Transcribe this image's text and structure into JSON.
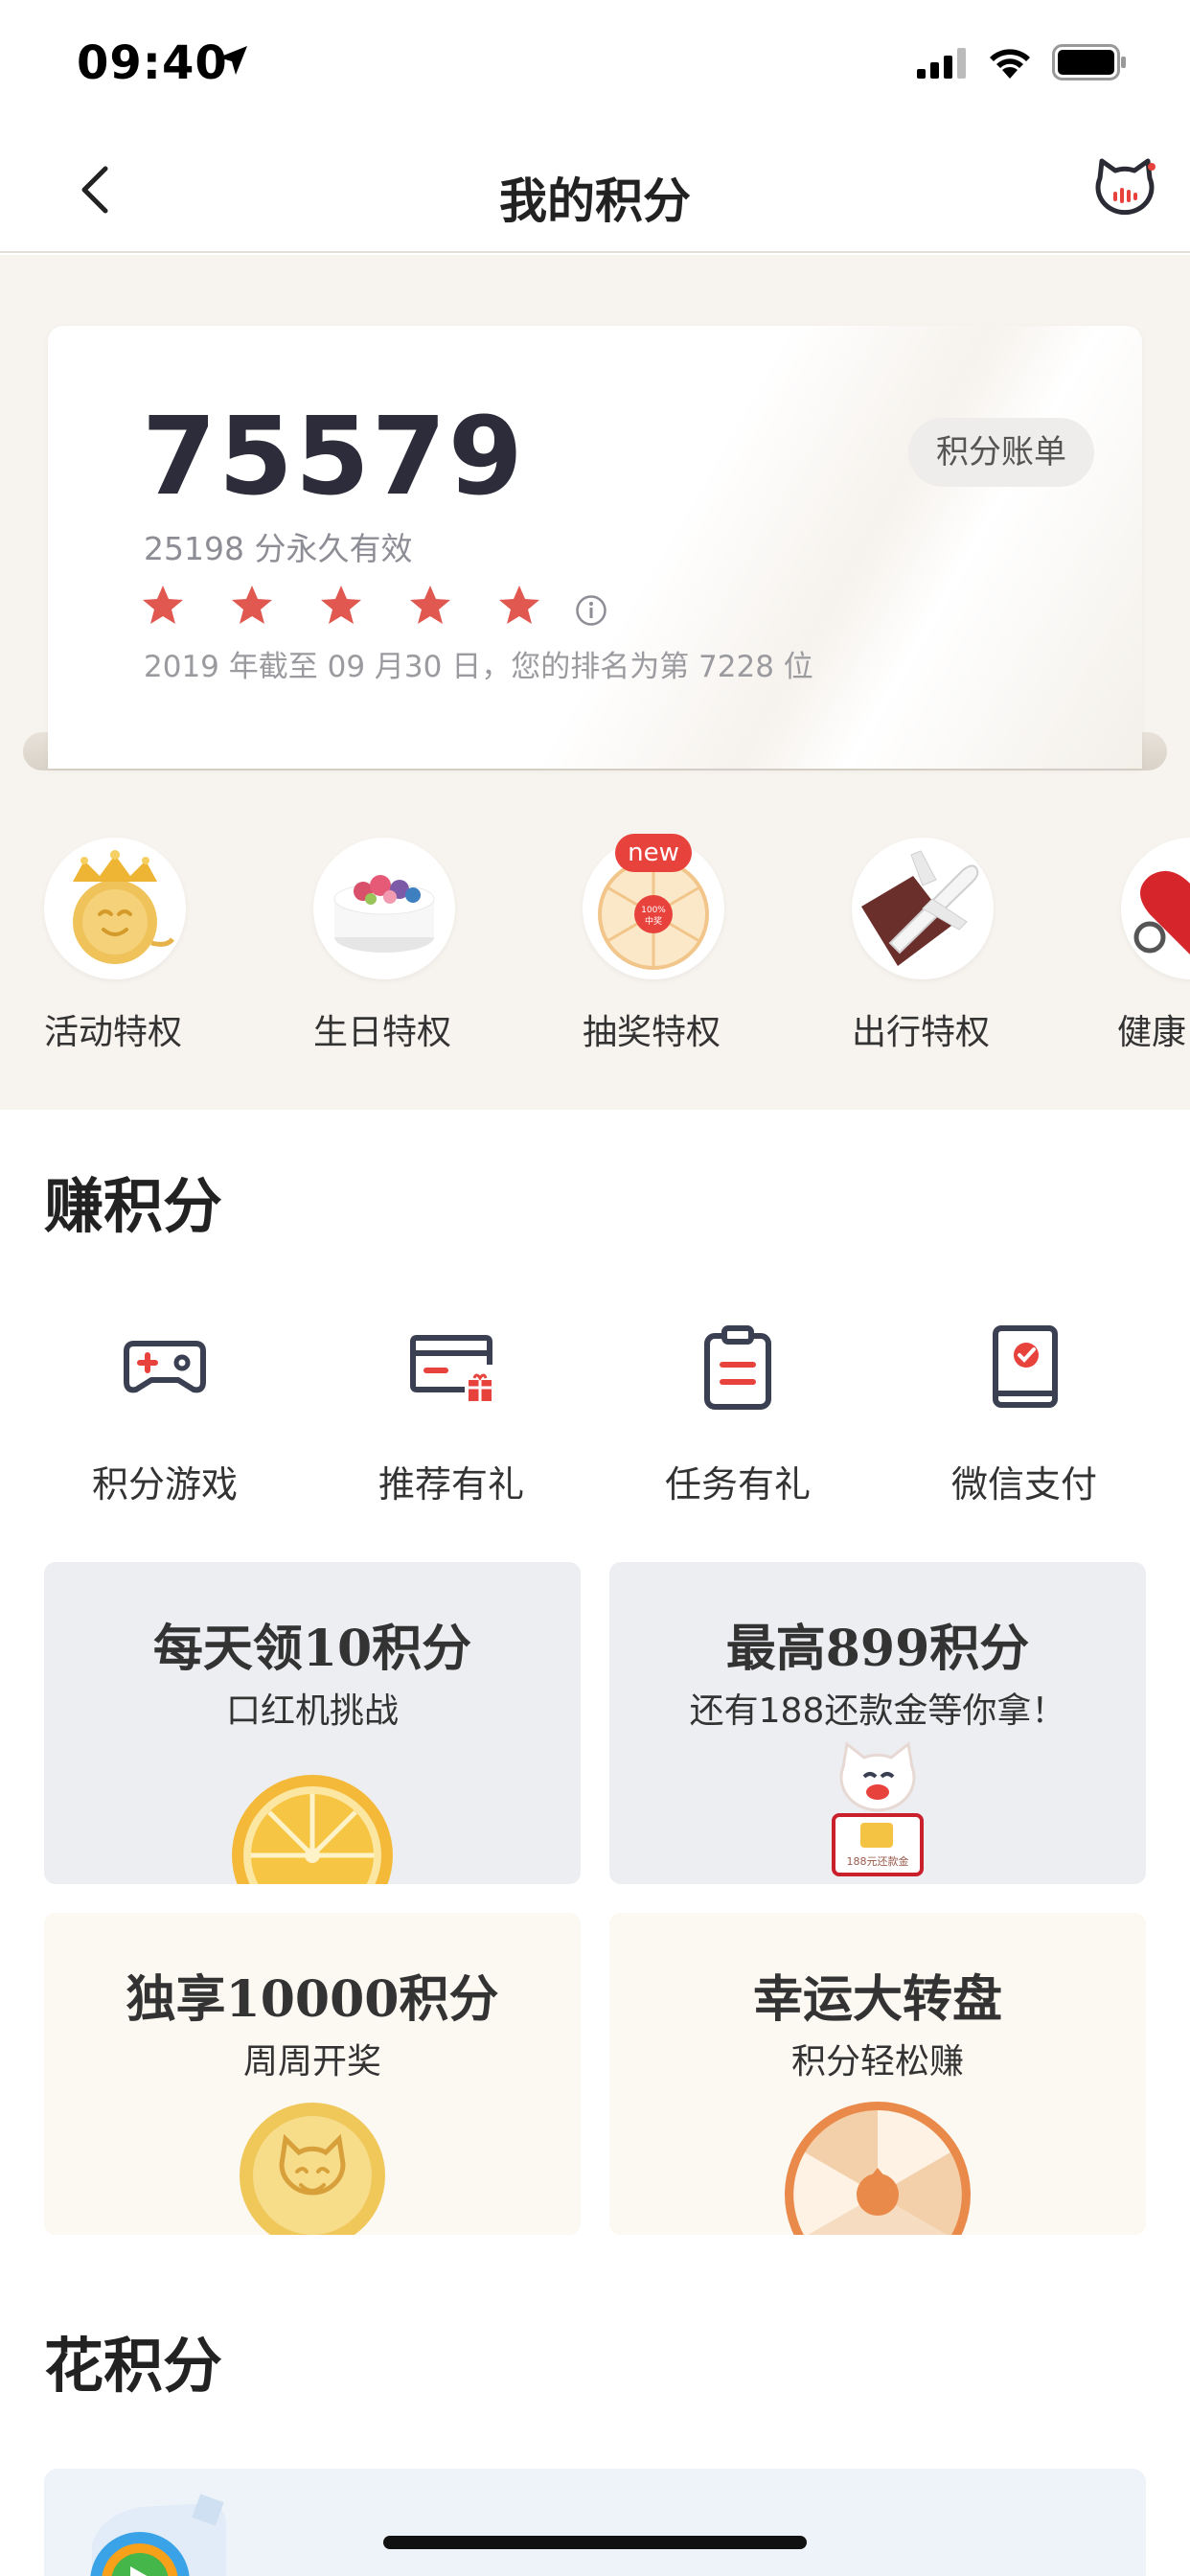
{
  "status_bar": {
    "time": "09:40"
  },
  "nav": {
    "title": "我的积分"
  },
  "points_card": {
    "total": "75579",
    "permanent_note": "25198 分永久有效",
    "star_count": 5,
    "rank_note": "2019 年截至 09 月30 日，您的排名为第 7228 位",
    "bill_button": "积分账单"
  },
  "privileges": [
    {
      "label": "活动特权",
      "icon": "crown-coin-icon"
    },
    {
      "label": "生日特权",
      "icon": "cake-icon"
    },
    {
      "label": "抽奖特权",
      "icon": "lottery-wheel-icon",
      "badge": "new",
      "wheel_text": "100%\n中奖"
    },
    {
      "label": "出行特权",
      "icon": "airplane-icon"
    },
    {
      "label": "健康",
      "icon": "heart-icon"
    }
  ],
  "earn_section": {
    "title": "赚积分",
    "items": [
      {
        "label": "积分游戏",
        "icon": "gamepad-icon"
      },
      {
        "label": "推荐有礼",
        "icon": "card-gift-icon"
      },
      {
        "label": "任务有礼",
        "icon": "clipboard-icon"
      },
      {
        "label": "微信支付",
        "icon": "wechat-pay-icon"
      }
    ],
    "promos": [
      {
        "title": "每天领10积分",
        "subtitle": "口红机挑战",
        "art": "orange-slice"
      },
      {
        "title": "最高899积分",
        "subtitle": "还有188还款金等你拿！",
        "art": "mascot-card",
        "art_text": "188元还款金"
      },
      {
        "title": "独享10000积分",
        "subtitle": "周周开奖",
        "art": "gold-coin"
      },
      {
        "title": "幸运大转盘",
        "subtitle": "积分轻松赚",
        "art": "spin-wheel"
      }
    ]
  },
  "spend_section": {
    "title": "花积分"
  },
  "colors": {
    "accent_red": "#e8423c",
    "star_red": "#e0584f",
    "page_bg": "#f7f3ee"
  }
}
